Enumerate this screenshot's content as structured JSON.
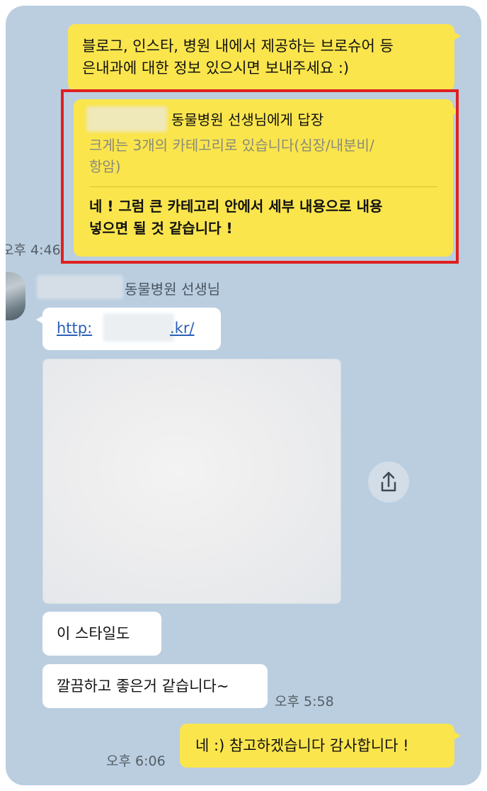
{
  "messages": {
    "request_line1": "블로그, 인스타, 병원 내에서 제공하는 브로슈어 등",
    "request_line2": "은내과에 대한 정보 있으시면 보내주세요 :)",
    "reply_header_suffix": "동물병원 선생님에게 답장",
    "quoted_line1": "크게는 3개의 카테고리로 있습니다(심장/내분비/",
    "quoted_line2": "항암)",
    "reply_line1": "네 ! 그럼 큰 카테고리 안에서 세부 내용으로 내용",
    "reply_line2": "넣으면 될 것 같습니다 !",
    "reply_time": "오후 4:46",
    "sender_suffix": "동물병원 선생님",
    "link_prefix": "http:",
    "link_suffix": ".kr/",
    "style_msg": "이 스타일도",
    "clean_msg": "깔끔하고 좋은거 같습니다~",
    "clean_time": "오후 5:58",
    "thanks_msg": "네 :) 참고하겠습니다 감사합니다 !",
    "thanks_time": "오후 6:06"
  },
  "colors": {
    "background": "#bacee0",
    "my_bubble": "#fae54d",
    "their_bubble": "#ffffff",
    "highlight_border": "#e02020"
  },
  "icons": {
    "share": "share-icon"
  }
}
